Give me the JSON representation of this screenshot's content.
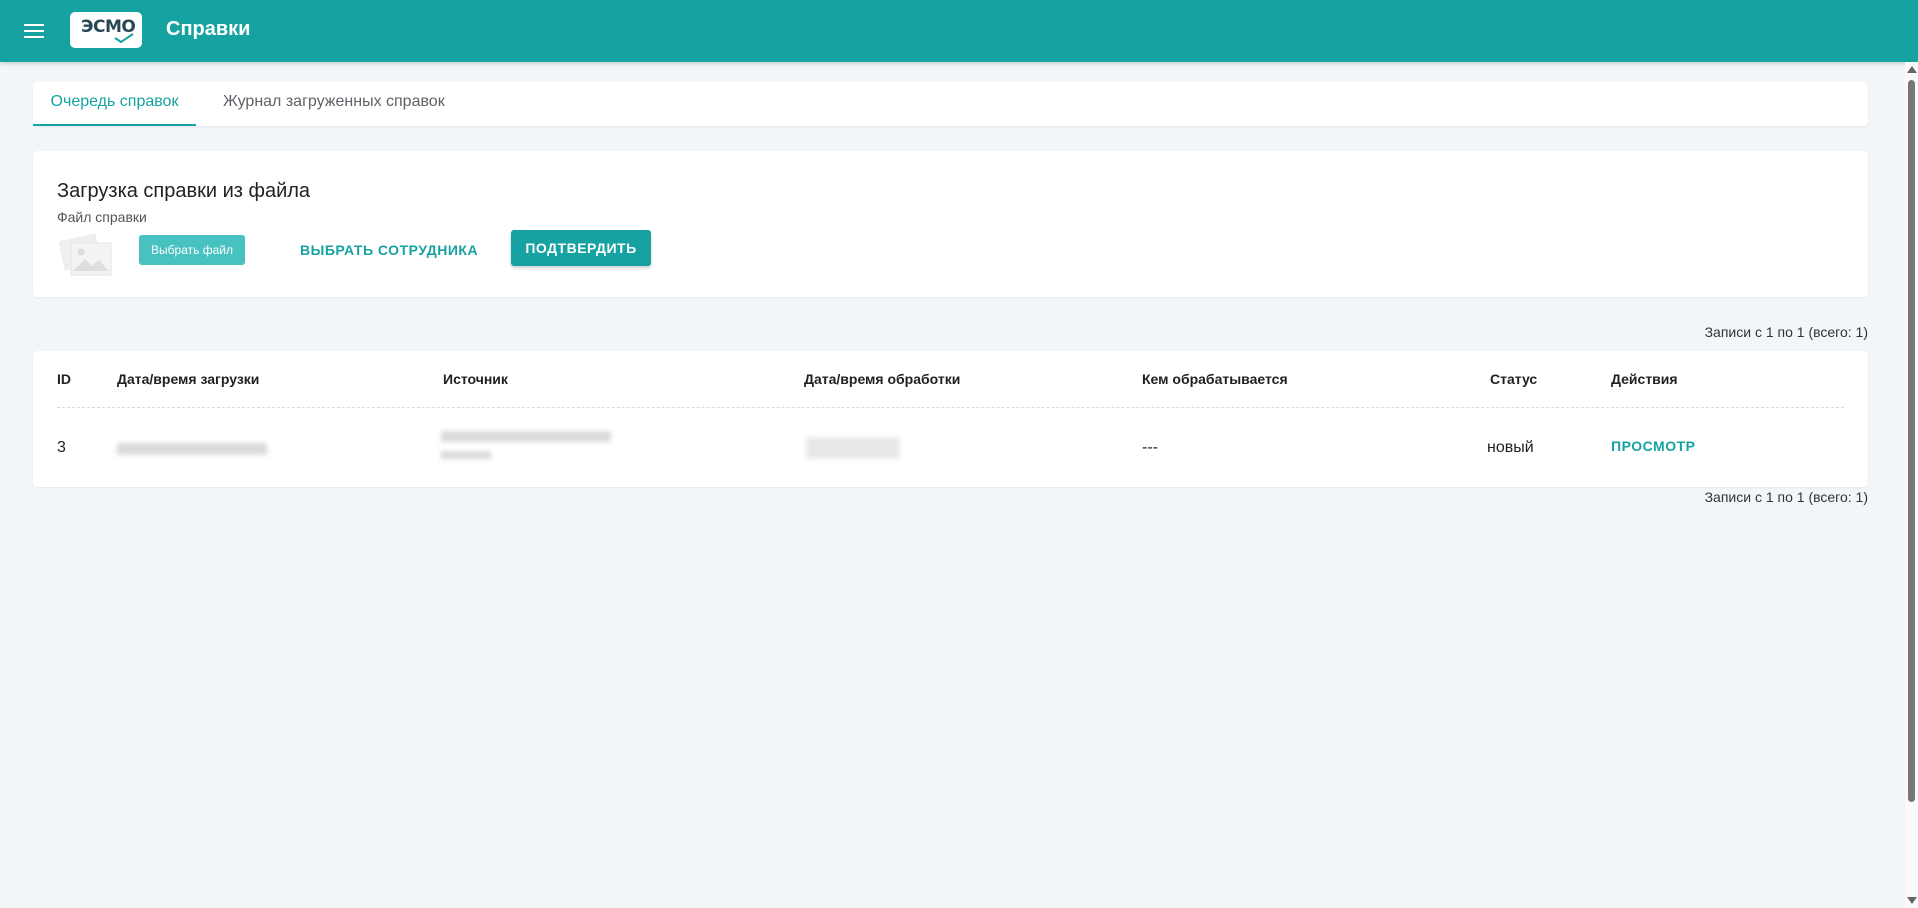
{
  "app": {
    "title": "Справки",
    "logo_text": "ЭСМО"
  },
  "tabs": [
    {
      "label": "Очередь справок",
      "active": true
    },
    {
      "label": "Журнал загруженных справок",
      "active": false
    }
  ],
  "upload": {
    "title": "Загрузка справки из файла",
    "file_label": "Файл справки",
    "choose_file_label": "Выбрать файл",
    "select_employee_label": "ВЫБРАТЬ СОТРУДНИКА",
    "confirm_label": "ПОДТВЕРДИТЬ"
  },
  "pagination": {
    "records_text": "Записи с 1 по 1 (всего: 1)"
  },
  "table": {
    "columns": [
      "ID",
      "Дата/время загрузки",
      "Источник",
      "Дата/время обработки",
      "Кем обрабатывается",
      "Статус",
      "Действия"
    ],
    "rows": [
      {
        "id": "3",
        "processed_by": "---",
        "status": "новый",
        "action": "ПРОСМОТР"
      }
    ]
  },
  "colors": {
    "accent": "#17a2a2",
    "accent_light": "#48c1c1",
    "background": "#f2f6f8"
  },
  "icons": {
    "menu": "hamburger-menu-icon",
    "file_preview": "image-placeholder-icon"
  }
}
